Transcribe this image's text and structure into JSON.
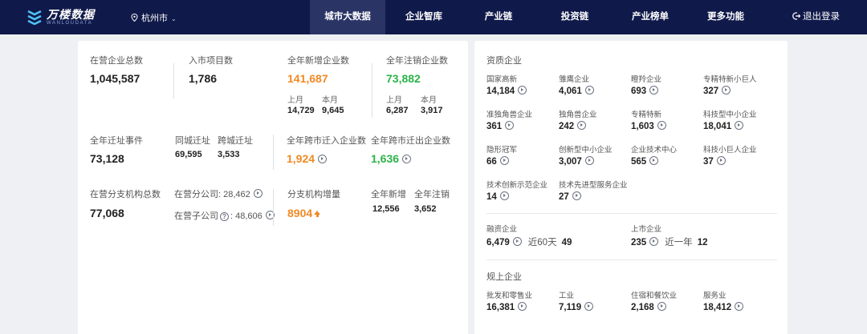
{
  "nav": {
    "logo_text": "万楼数据",
    "logo_sub": "WANLOUDATA",
    "city": "杭州市",
    "items": [
      "城市大数据",
      "企业智库",
      "产业链",
      "投资链",
      "产业榜单",
      "更多功能"
    ],
    "logout": "退出登录",
    "active_color": "#2a3566"
  },
  "left": {
    "total_enterprises": {
      "label": "在营企业总数",
      "value": "1,045,587"
    },
    "projects": {
      "label": "入市项目数",
      "value": "1,786"
    },
    "new_year": {
      "label": "全年新增企业数",
      "value": "141,687",
      "last_label": "上月",
      "last_value": "14,729",
      "this_label": "本月",
      "this_value": "9,645"
    },
    "cancel_year": {
      "label": "全年注销企业数",
      "value": "73,882",
      "last_label": "上月",
      "last_value": "6,287",
      "this_label": "本月",
      "this_value": "3,917"
    },
    "relocate": {
      "label": "全年迁址事件",
      "value": "73,128",
      "same_label": "同城迁址",
      "same_value": "69,595",
      "cross_label": "跨城迁址",
      "cross_value": "3,533"
    },
    "cross_in": {
      "label": "全年跨市迁入企业数",
      "value": "1,924"
    },
    "cross_out": {
      "label": "全年跨市迁出企业数",
      "value": "1,636"
    },
    "branches": {
      "label": "在营分支机构总数",
      "value": "77,068",
      "branch_label": "在营分公司:",
      "branch_value": "28,462",
      "sub_label": "在营子公司",
      "sub_value": "48,606"
    },
    "branch_growth": {
      "label": "分支机构增量",
      "value": "8904",
      "new_label": "全年新增",
      "new_value": "12,556",
      "cancel_label": "全年注销",
      "cancel_value": "3,652"
    }
  },
  "right": {
    "qualification_title": "资质企业",
    "qualifications": [
      {
        "label": "国家高新",
        "value": "14,184"
      },
      {
        "label": "雏鹰企业",
        "value": "4,061"
      },
      {
        "label": "瞪羚企业",
        "value": "693"
      },
      {
        "label": "专精特新小巨人",
        "value": "327"
      },
      {
        "label": "准独角兽企业",
        "value": "361"
      },
      {
        "label": "独角兽企业",
        "value": "242"
      },
      {
        "label": "专精特新",
        "value": "1,603"
      },
      {
        "label": "科技型中小企业",
        "value": "18,041"
      },
      {
        "label": "隐形冠军",
        "value": "66"
      },
      {
        "label": "创新型中小企业",
        "value": "3,007"
      },
      {
        "label": "企业技术中心",
        "value": "565"
      },
      {
        "label": "科技小巨人企业",
        "value": "37"
      },
      {
        "label": "技术创新示范企业",
        "value": "14"
      },
      {
        "label": "技术先进型服务企业",
        "value": "27"
      }
    ],
    "financing": {
      "label": "融资企业",
      "value": "6,479",
      "recent_label": "近60天",
      "recent_value": "49"
    },
    "listed": {
      "label": "上市企业",
      "value": "235",
      "recent_label": "近一年",
      "recent_value": "12"
    },
    "scale_title": "规上企业",
    "scale": [
      {
        "label": "批发和零售业",
        "value": "16,381"
      },
      {
        "label": "工业",
        "value": "7,119"
      },
      {
        "label": "住宿和餐饮业",
        "value": "2,168"
      },
      {
        "label": "服务业",
        "value": "18,412"
      }
    ]
  }
}
